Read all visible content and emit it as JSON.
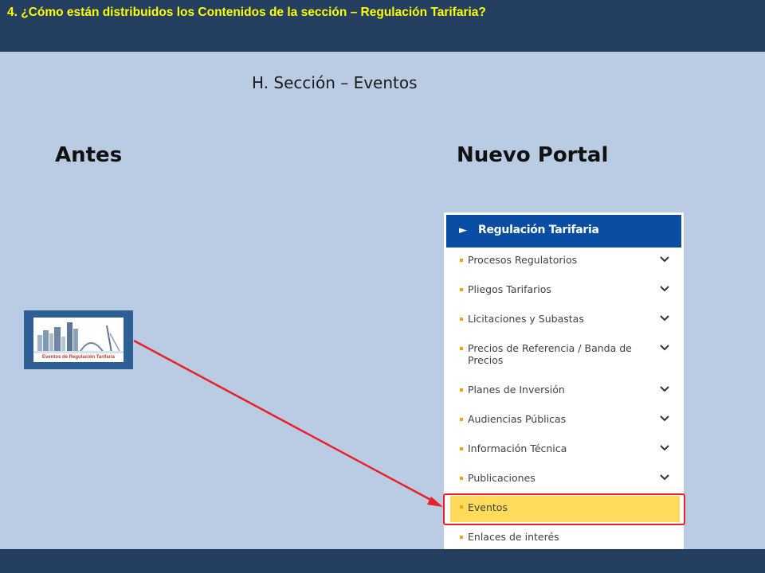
{
  "header": {
    "title": "4. ¿Cómo están distribuidos los Contenidos de la sección –  Regulación Tarifaria?"
  },
  "subtitle": "H. Sección – Eventos",
  "columns": {
    "before": "Antes",
    "after": "Nuevo Portal"
  },
  "banner": {
    "caption": "Eventos de Regulación Tarifaria"
  },
  "menu": {
    "title": "Regulación Tarifaria",
    "items": [
      {
        "label": "Procesos Regulatorios",
        "has_chevron": true
      },
      {
        "label": "Pliegos Tarifarios",
        "has_chevron": true
      },
      {
        "label": "Licitaciones y Subastas",
        "has_chevron": true
      },
      {
        "label": "Precios de Referencia / Banda de Precios",
        "has_chevron": true
      },
      {
        "label": "Planes de Inversión",
        "has_chevron": true
      },
      {
        "label": "Audiencias Públicas",
        "has_chevron": true
      },
      {
        "label": "Información Técnica",
        "has_chevron": true
      },
      {
        "label": "Publicaciones",
        "has_chevron": true
      },
      {
        "label": "Eventos",
        "has_chevron": false,
        "active": true
      },
      {
        "label": "Enlaces de interés",
        "has_chevron": false
      }
    ]
  },
  "colors": {
    "background": "#b9cce4",
    "bar": "#243f60",
    "title_text": "#ffff00",
    "menu_header": "#0a4ea3",
    "bullet": "#f0a500",
    "active_item": "#ffdb5c",
    "highlight": "#e8202a"
  }
}
